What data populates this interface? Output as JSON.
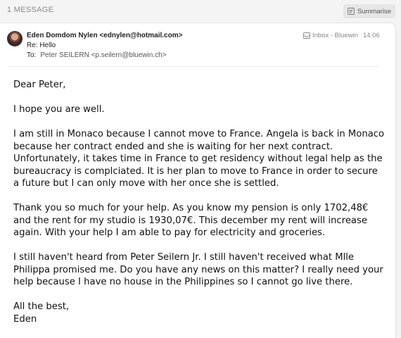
{
  "thread": {
    "message_count": "1 MESSAGE",
    "summarise_label": "Summarise"
  },
  "message": {
    "from": "Eden Domdom Nylen <ednylen@hotmail.com>",
    "subject": "Re: Hello",
    "to_label": "To:",
    "to": "Peter SEILERN <p.seilern@bluewin.ch>",
    "mailbox": "Inbox - Bluewin",
    "time": "14:06",
    "body": {
      "greeting": "Dear Peter,",
      "p1": "I hope you are well.",
      "p2": "I am still in Monaco because I cannot move to France. Angela is back in Monaco because her contract ended and she is waiting for her next contract. Unfortunately, it takes time in France to get residency without legal help as the bureaucracy is complciated. It is her plan to move to France in order to secure a future but I can only move with her once she is settled.",
      "p3": "Thank you so much for your help. As you know my pension is only 1702,48€ and the rent for my studio is 1930,07€. This december my rent will increase again. With your help I am able to pay for electricity and groceries.",
      "p4": "I still haven't heard from Peter Seilern Jr. I still haven't received what Mlle Philippa promised me. Do you have any news on this matter? I really need your help because I have no house in the Philippines so I cannot go live there.",
      "closing": "All the best,",
      "signature": "Eden"
    }
  },
  "icons": {
    "summarise": "summarise-icon",
    "mailbox": "inbox-tray-icon",
    "avatar": "sender-avatar"
  }
}
